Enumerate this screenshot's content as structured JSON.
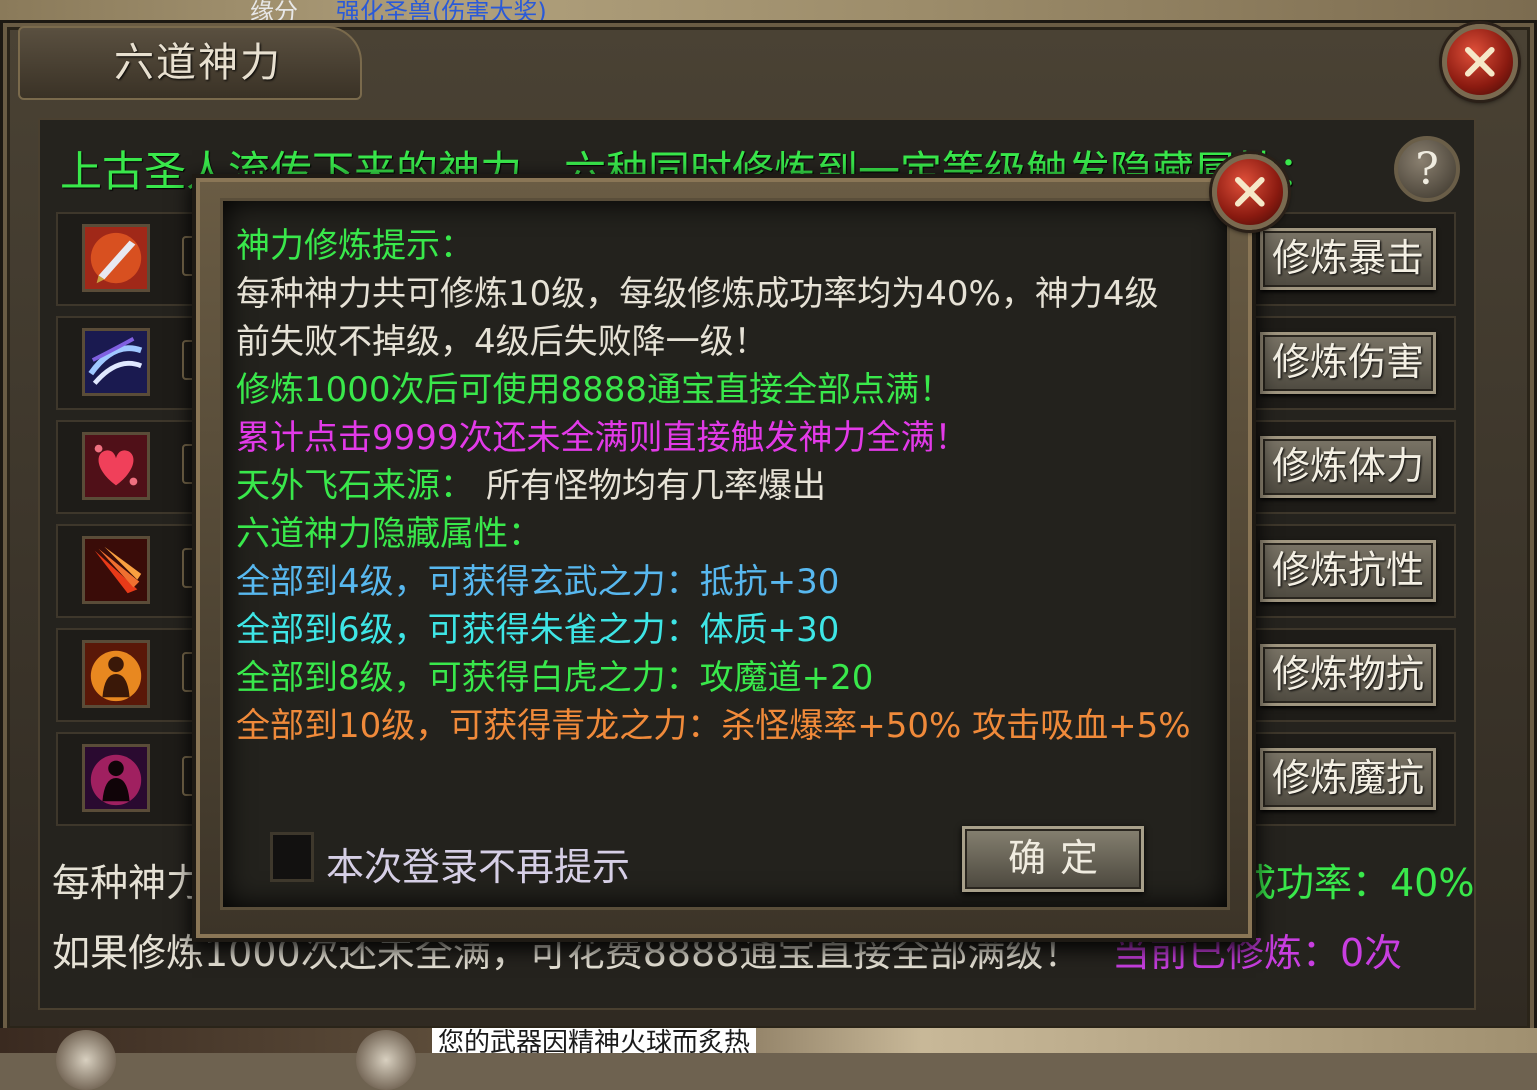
{
  "background": {
    "top_texts": [
      "缘分",
      "强化圣兽(伤害大奖)"
    ],
    "bottom_message": "您的武器因精神火球而炙热"
  },
  "panel": {
    "title": "六道神力",
    "intro": "上古圣人流传下来的神力，六种同时修炼到一定等级触发隐藏属性：",
    "help_symbol": "?",
    "skills": [
      {
        "icon": "blade-skill-icon",
        "button": "修炼暴击"
      },
      {
        "icon": "lightning-skill-icon",
        "button": "修炼伤害"
      },
      {
        "icon": "heart-skill-icon",
        "button": "修炼体力"
      },
      {
        "icon": "fire-claw-skill-icon",
        "button": "修炼抗性"
      },
      {
        "icon": "golden-aura-skill-icon",
        "button": "修炼物抗"
      },
      {
        "icon": "dark-aura-skill-icon",
        "button": "修炼魔抗"
      }
    ],
    "footer_line1_left": "每种神力",
    "footer_line1_right": "成功率：40%",
    "footer_line2_left": "如果修炼1000次还未全满，可花费8888通宝直接全部满级！",
    "footer_line2_right": "当前已修炼：0次"
  },
  "popup": {
    "lines": [
      "神力修炼提示：",
      "每种神力共可修炼10级，每级修炼成功率均为40%，神力4级",
      "前失败不掉级，4级后失败降一级！",
      "修炼1000次后可使用8888通宝直接全部点满！",
      "累计点击9999次还未全满则直接触发神力全满！",
      "天外飞石来源：",
      "所有怪物均有几率爆出",
      "六道神力隐藏属性：",
      "全部到4级，可获得玄武之力：抵抗+30",
      "全部到6级，可获得朱雀之力：体质+30",
      "全部到8级，可获得白虎之力：攻魔道+20",
      "全部到10级，可获得青龙之力：杀怪爆率+50%  攻击吸血+5%"
    ],
    "checkbox_label": "本次登录不再提示",
    "confirm": "确定"
  },
  "colors": {
    "green": "#39e84b",
    "white": "#e6e2d6",
    "magenta": "#e23ae8",
    "blue": "#58b8ef",
    "cyan": "#3ee6e6",
    "orange": "#f08a3a",
    "purple": "#c83ee0"
  }
}
